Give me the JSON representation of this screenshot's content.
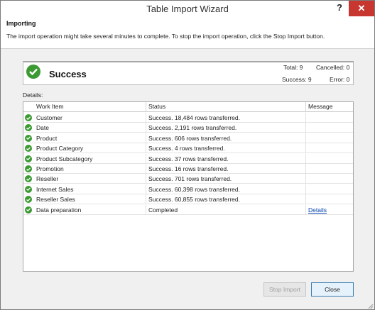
{
  "window": {
    "title": "Table Import Wizard",
    "help_label": "?",
    "close_label": "✕"
  },
  "header": {
    "title": "Importing",
    "description": "The import operation might take several minutes to complete. To stop the import operation, click the Stop Import button."
  },
  "summary": {
    "status": "Success",
    "total_label": "Total: 9",
    "cancelled_label": "Cancelled: 0",
    "success_label": "Success: 9",
    "error_label": "Error: 0"
  },
  "details_label": "Details:",
  "columns": {
    "work_item": "Work Item",
    "status": "Status",
    "message": "Message"
  },
  "rows": [
    {
      "work_item": "Customer",
      "status": "Success. 18,484 rows transferred.",
      "message": ""
    },
    {
      "work_item": "Date",
      "status": "Success. 2,191 rows transferred.",
      "message": ""
    },
    {
      "work_item": "Product",
      "status": "Success. 606 rows transferred.",
      "message": ""
    },
    {
      "work_item": "Product Category",
      "status": "Success. 4 rows transferred.",
      "message": ""
    },
    {
      "work_item": "Product Subcategory",
      "status": "Success. 37 rows transferred.",
      "message": ""
    },
    {
      "work_item": "Promotion",
      "status": "Success. 16 rows transferred.",
      "message": ""
    },
    {
      "work_item": "Reseller",
      "status": "Success. 701 rows transferred.",
      "message": ""
    },
    {
      "work_item": "Internet Sales",
      "status": "Success. 60,398 rows transferred.",
      "message": ""
    },
    {
      "work_item": "Reseller Sales",
      "status": "Success. 60,855 rows transferred.",
      "message": ""
    },
    {
      "work_item": "Data preparation",
      "status": "Completed",
      "message": "Details"
    }
  ],
  "buttons": {
    "stop_import": "Stop Import",
    "close": "Close"
  },
  "colors": {
    "success_green": "#3c9a32",
    "close_red": "#c7372f",
    "link_blue": "#0645ad"
  },
  "icons": {
    "row_status": "check-circle-icon",
    "summary_status": "check-circle-icon"
  }
}
